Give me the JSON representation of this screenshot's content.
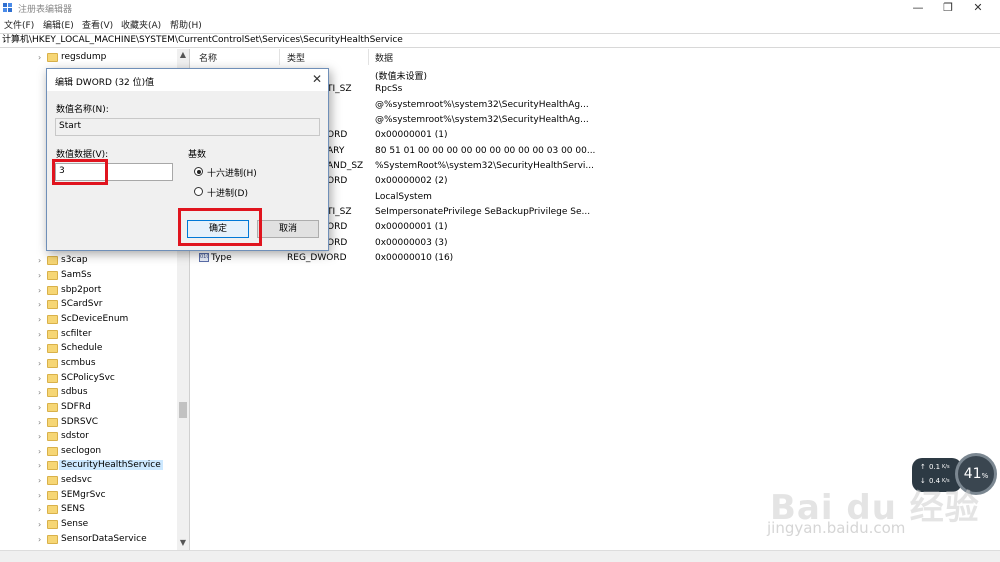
{
  "window": {
    "title": "注册表编辑器",
    "minimize": "—",
    "maximize": "❐",
    "close": "✕"
  },
  "menu": [
    "文件(F)",
    "编辑(E)",
    "查看(V)",
    "收藏夹(A)",
    "帮助(H)"
  ],
  "address": "计算机\\HKEY_LOCAL_MACHINE\\SYSTEM\\CurrentControlSet\\Services\\SecurityHealthService",
  "tree": {
    "top_item": "regsdump",
    "items": [
      "s3cap",
      "SamSs",
      "sbp2port",
      "SCardSvr",
      "ScDeviceEnum",
      "scfilter",
      "Schedule",
      "scmbus",
      "SCPolicySvc",
      "sdbus",
      "SDFRd",
      "SDRSVC",
      "sdstor",
      "seclogon",
      "SecurityHealthService",
      "sedsvc",
      "SEMgrSvc",
      "SENS",
      "Sense",
      "SensorDataService"
    ],
    "selected": "SecurityHealthService"
  },
  "values": {
    "headers": [
      "名称",
      "类型",
      "数据"
    ],
    "rows": [
      {
        "type": "",
        "data": "(数值未设置)"
      },
      {
        "type": "TI_SZ",
        "data": "RpcSs"
      },
      {
        "type": "",
        "data": "@%systemroot%\\system32\\SecurityHealthAg..."
      },
      {
        "type": "",
        "data": "@%systemroot%\\system32\\SecurityHealthAg..."
      },
      {
        "type": "ORD",
        "data": "0x00000001 (1)"
      },
      {
        "type": "ARY",
        "data": "80 51 01 00 00 00 00 00 00 00 00 00 03 00 00..."
      },
      {
        "type": "AND_SZ",
        "data": "%SystemRoot%\\system32\\SecurityHealthServi..."
      },
      {
        "type": "ORD",
        "data": "0x00000002 (2)"
      },
      {
        "type": "",
        "data": "LocalSystem"
      },
      {
        "type": "TI_SZ",
        "data": "SeImpersonatePrivilege SeBackupPrivilege Se..."
      },
      {
        "type": "ORD",
        "data": "0x00000001 (1)"
      },
      {
        "type": "ORD",
        "data": "0x00000003 (3)"
      }
    ],
    "last_row": {
      "name": "Type",
      "type": "REG_DWORD",
      "data": "0x00000010 (16)"
    }
  },
  "dialog": {
    "title": "编辑 DWORD (32 位)值",
    "name_label": "数值名称(N):",
    "name_value": "Start",
    "data_label": "数值数据(V):",
    "data_value": "3",
    "base_label": "基数",
    "radio_hex": "十六进制(H)",
    "radio_dec": "十进制(D)",
    "ok": "确定",
    "cancel": "取消"
  },
  "speed_widget": {
    "up": "0.1",
    "up_unit": "K/s",
    "down": "0.4",
    "down_unit": "K/s",
    "percent": "41",
    "percent_unit": "%"
  },
  "watermark": {
    "main": "Bai du 经验",
    "sub": "jingyan.baidu.com"
  },
  "colors": {
    "highlight_red": "#e0141e",
    "selection": "#cce8ff",
    "folder": "#f6d675"
  }
}
